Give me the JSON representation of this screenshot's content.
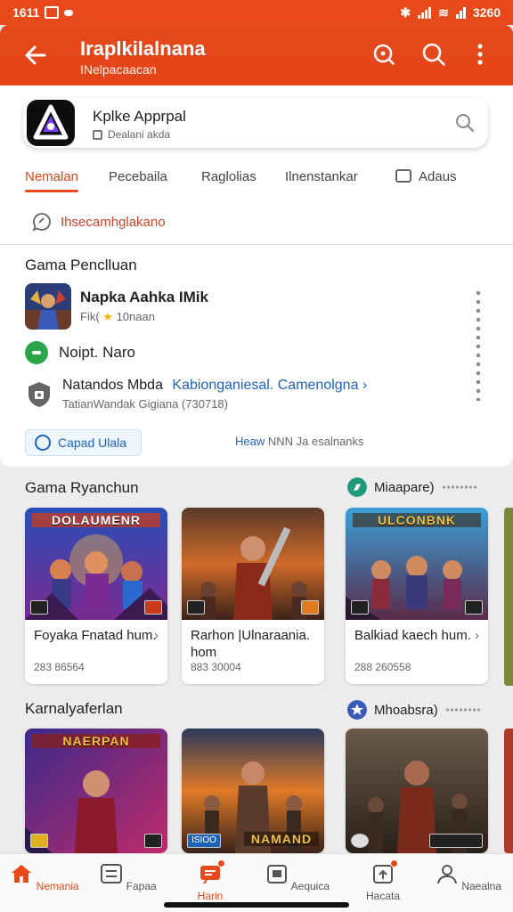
{
  "status_bar": {
    "time": "1611",
    "clock": "3260"
  },
  "app_bar": {
    "title": "Iraplkilalnana",
    "subtitle": "INelpacaacan"
  },
  "search_card": {
    "app_name": "Kplke Apprpal",
    "subtitle": "Dealani akda"
  },
  "tabs": [
    {
      "label": "Nemalan"
    },
    {
      "label": "Pecebaila"
    },
    {
      "label": "Raglolias"
    },
    {
      "label": "Ilnenstankar"
    },
    {
      "label": "Adaus"
    }
  ],
  "chip": {
    "label": "Ihsecamhglakano"
  },
  "details": {
    "section_title": "Gama Penclluan",
    "game_name": "Napka Aahka IMik",
    "game_sub_prefix": "Fik(",
    "game_sub_rating": "10naan",
    "status_label": "Noipt. Naro",
    "dev_name": "Natandos Mbda",
    "dev_link": "Kabionganiesal. Camenolgna",
    "dev_sub": "TatianWandak Gigiana (730718)",
    "button_label": "Capad Ulala",
    "footer_link": "Heaw",
    "footer_text": "NNN Ja esalnanks"
  },
  "section1": {
    "title": "Gama Ryanchun",
    "side_label": "Miaapare)",
    "cards": [
      {
        "banner": "DOLAUMENR",
        "name": "Foyaka Fnatad hum.",
        "count": "283 86564"
      },
      {
        "banner": "",
        "name": "Rarhon |Ulnaraania. hom",
        "count": "883 30004"
      },
      {
        "banner": "ULCONBNK",
        "name": "Balkiad kaech hum.",
        "count": "288 260558"
      }
    ]
  },
  "section2": {
    "title": "Karnalyaferlan",
    "side_label": "Mhoabsra)",
    "cards": [
      {
        "banner": "NAERPAN"
      },
      {
        "banner": "NAMAND",
        "badge": "ISIOO"
      },
      {
        "banner": ""
      }
    ]
  },
  "bottom_nav": [
    {
      "label": "Nemania",
      "icon": "home-icon"
    },
    {
      "label": "Fapaa",
      "icon": "grid-icon"
    },
    {
      "label": "Harin",
      "icon": "card-icon"
    },
    {
      "label": "Aequica",
      "icon": "calendar-icon"
    },
    {
      "label": "Hacata",
      "icon": "upload-icon"
    },
    {
      "label": "Naealna",
      "icon": "person-icon"
    }
  ],
  "colors": {
    "accent": "#e8491a",
    "link": "#1f63b8",
    "green": "#2aa54a"
  }
}
